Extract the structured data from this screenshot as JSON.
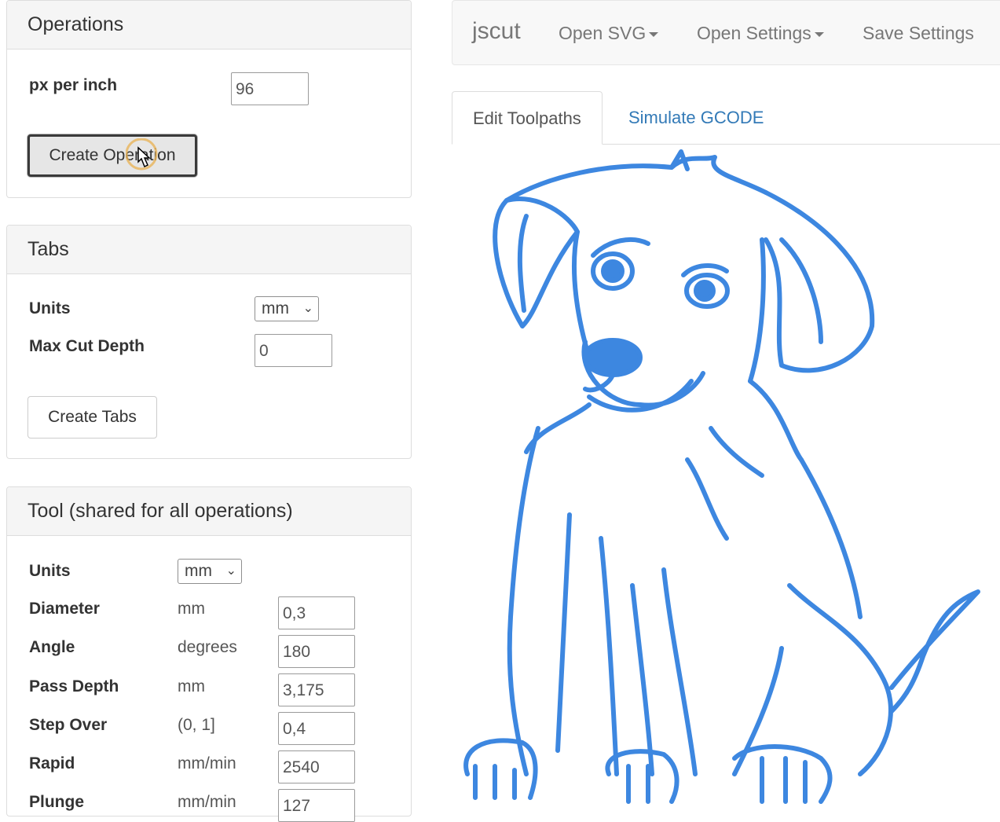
{
  "operations": {
    "title": "Operations",
    "px_per_inch_label": "px per inch",
    "px_per_inch_value": "96",
    "create_button": "Create Operation"
  },
  "tabs_panel": {
    "title": "Tabs",
    "units_label": "Units",
    "units_value": "mm",
    "max_cut_depth_label": "Max Cut Depth",
    "max_cut_depth_value": "0",
    "create_button": "Create Tabs"
  },
  "tool": {
    "title": "Tool (shared for all operations)",
    "units_label": "Units",
    "units_value": "mm",
    "rows": [
      {
        "label": "Diameter",
        "unit": "mm",
        "value": "0,3"
      },
      {
        "label": "Angle",
        "unit": "degrees",
        "value": "180"
      },
      {
        "label": "Pass Depth",
        "unit": "mm",
        "value": "3,175"
      },
      {
        "label": "Step Over",
        "unit": "(0, 1]",
        "value": "0,4"
      },
      {
        "label": "Rapid",
        "unit": "mm/min",
        "value": "2540"
      },
      {
        "label": "Plunge",
        "unit": "mm/min",
        "value": "127"
      }
    ]
  },
  "navbar": {
    "brand": "jscut",
    "open_svg": "Open SVG",
    "open_settings": "Open Settings",
    "save_settings": "Save Settings"
  },
  "main_tabs": {
    "edit": "Edit Toolpaths",
    "simulate": "Simulate GCODE"
  },
  "colors": {
    "drawing_stroke": "#3d87e0",
    "link": "#337ab7"
  },
  "icons": [
    "hand-pointer-icon",
    "caret-down-icon",
    "chevron-down-icon"
  ]
}
